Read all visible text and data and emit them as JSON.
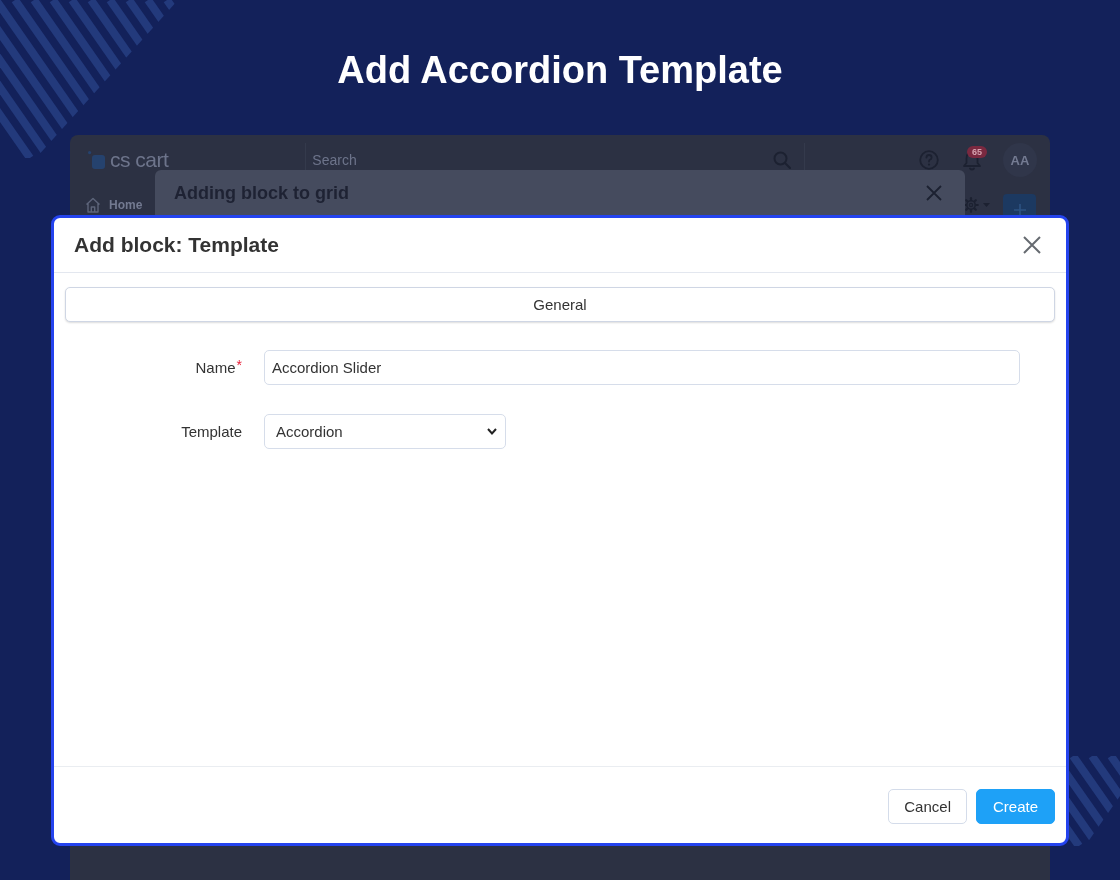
{
  "banner": {
    "title": "Add Accordion Template"
  },
  "background_app": {
    "logo_text": "cs cart",
    "search": {
      "placeholder": "Search"
    },
    "notification_count": "65",
    "avatar_initials": "AA",
    "nav_items": [
      {
        "label": "Home"
      }
    ]
  },
  "parent_dialog": {
    "title": "Adding block to grid"
  },
  "dialog": {
    "title": "Add block: Template",
    "tabs": [
      {
        "label": "General",
        "selected": true
      }
    ],
    "fields": [
      {
        "kind": "text",
        "label": "Name",
        "required_mark": "*",
        "value": "Accordion Slider"
      },
      {
        "kind": "select",
        "label": "Template",
        "value": "Accordion"
      }
    ],
    "buttons": [
      {
        "kind": "secondary",
        "label": "Cancel"
      },
      {
        "kind": "primary",
        "label": "Create"
      }
    ]
  }
}
